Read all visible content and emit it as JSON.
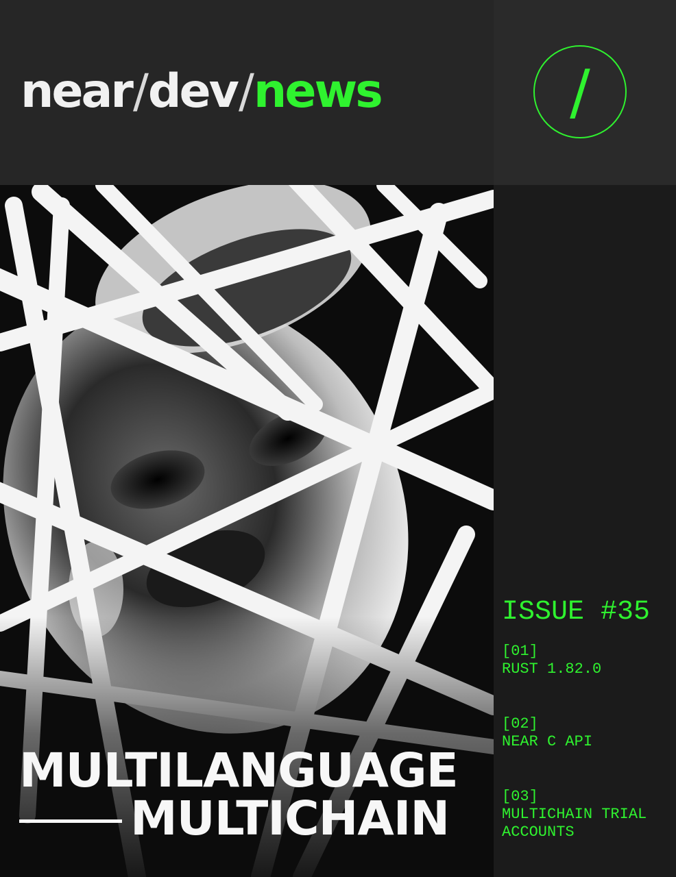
{
  "masthead": {
    "part1": "near",
    "slash1": "/",
    "part2": "dev",
    "slash2": "/",
    "part3": "news",
    "logo_glyph": "/"
  },
  "headline": {
    "line1": "MULTILANGUAGE",
    "line2": "MULTICHAIN"
  },
  "sidebar": {
    "issue": "ISSUE #35",
    "toc": [
      {
        "num": "[01]",
        "title": "RUST 1.82.0"
      },
      {
        "num": "[02]",
        "title": "NEAR C API"
      },
      {
        "num": "[03]",
        "title": "MULTICHAIN TRIAL ACCOUNTS"
      }
    ]
  },
  "colors": {
    "accent": "#2ff22f",
    "background": "#1b1b1b",
    "header": "#262626",
    "text": "#f1f1f1"
  }
}
